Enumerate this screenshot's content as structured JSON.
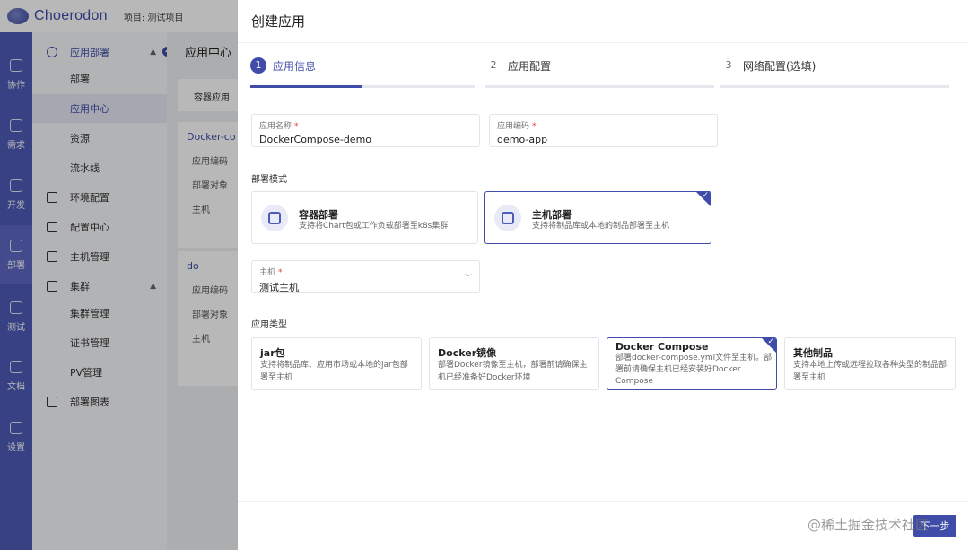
{
  "app": {
    "logo_text": "Choerodon",
    "project_label": "项目: 测试项目"
  },
  "rail": {
    "items": [
      {
        "label": "协作",
        "icon": "collab-icon"
      },
      {
        "label": "需求",
        "icon": "requirement-icon"
      },
      {
        "label": "开发",
        "icon": "code-icon"
      },
      {
        "label": "部署",
        "icon": "deploy-icon"
      },
      {
        "label": "测试",
        "icon": "test-icon"
      },
      {
        "label": "文档",
        "icon": "docs-icon"
      },
      {
        "label": "设置",
        "icon": "settings-icon"
      }
    ],
    "active": "部署"
  },
  "subnav": {
    "app_deploy": "应用部署",
    "deploy": "部署",
    "app_center": "应用中心",
    "resources": "资源",
    "pipeline": "流水线",
    "env_config": "环境配置",
    "config_center": "配置中心",
    "host_mgmt": "主机管理",
    "cluster": "集群",
    "cluster_mgmt": "集群管理",
    "cert_mgmt": "证书管理",
    "pv_mgmt": "PV管理",
    "deploy_chart": "部署图表"
  },
  "content": {
    "title": "应用中心",
    "tab": "容器应用",
    "card1_head": "Docker-co",
    "card1_lines": [
      "应用编码",
      "部署对象",
      "主机"
    ],
    "card2_head": "do",
    "card2_lines": [
      "应用编码",
      "部署对象",
      "主机"
    ]
  },
  "drawer": {
    "title": "创建应用",
    "steps": [
      {
        "num": "1",
        "label": "应用信息"
      },
      {
        "num": "2",
        "label": "应用配置"
      },
      {
        "num": "3",
        "label": "网络配置(选填)"
      }
    ],
    "step_progress": 0.5,
    "app_name": {
      "label": "应用名称",
      "value": "DockerCompose-demo"
    },
    "app_code": {
      "label": "应用编码",
      "value": "demo-app"
    },
    "deploy_mode_label": "部署模式",
    "deploy_modes": [
      {
        "title": "容器部署",
        "desc": "支持将Chart包或工作负载部署至k8s集群"
      },
      {
        "title": "主机部署",
        "desc": "支持将制品库或本地的制品部署至主机"
      }
    ],
    "host": {
      "label": "主机",
      "value": "测试主机"
    },
    "app_type_label": "应用类型",
    "app_types": [
      {
        "title": "jar包",
        "desc": "支持将制品库、应用市场或本地的jar包部署至主机"
      },
      {
        "title": "Docker镜像",
        "desc": "部署Docker镜像至主机，部署前请确保主机已经准备好Docker环境"
      },
      {
        "title": "Docker Compose",
        "desc": "部署docker-compose.yml文件至主机。部署前请确保主机已经安装好Docker Compose"
      },
      {
        "title": "其他制品",
        "desc": "支持本地上传或远程拉取各种类型的制品部署至主机"
      }
    ],
    "next_button": "下一步",
    "watermark": "@稀土掘金技术社区"
  },
  "colors": {
    "brand": "#3f4da8",
    "rail": "#4d5ab8",
    "required": "#e53935"
  }
}
